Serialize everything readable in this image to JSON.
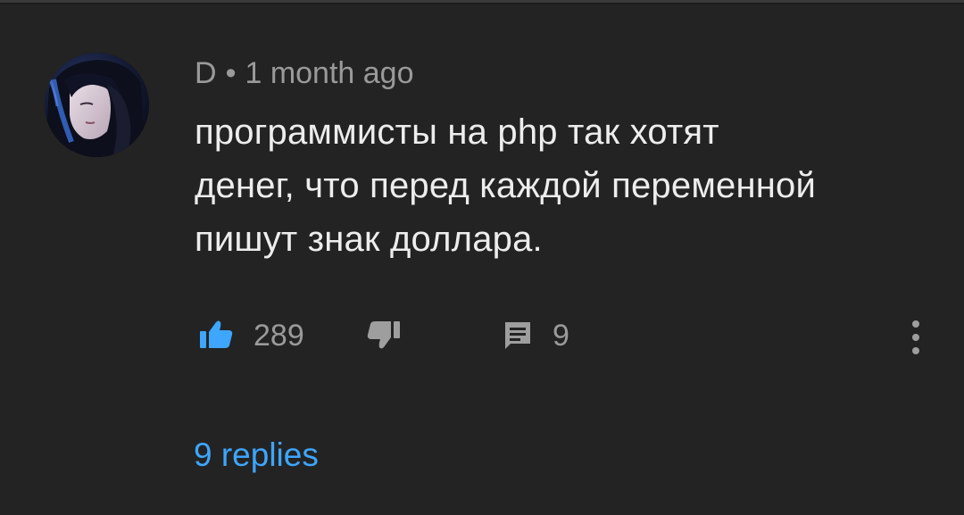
{
  "comment": {
    "author": "D",
    "separator": "•",
    "time": "1 month ago",
    "text_lines": [
      "программисты на php так хотят",
      "денег, что перед каждой переменной",
      "пишут знак доллара."
    ],
    "likes": "289",
    "replies_count": "9",
    "replies_link": "9 replies"
  },
  "icons": {
    "like": "thumbs-up-icon",
    "dislike": "thumbs-down-icon",
    "reply": "comment-icon",
    "more": "more-vertical-icon"
  },
  "colors": {
    "background": "#232323",
    "text": "#ededed",
    "meta": "#9a9a9a",
    "accent": "#3ea6ff",
    "like_active": "#3ea6ff"
  }
}
